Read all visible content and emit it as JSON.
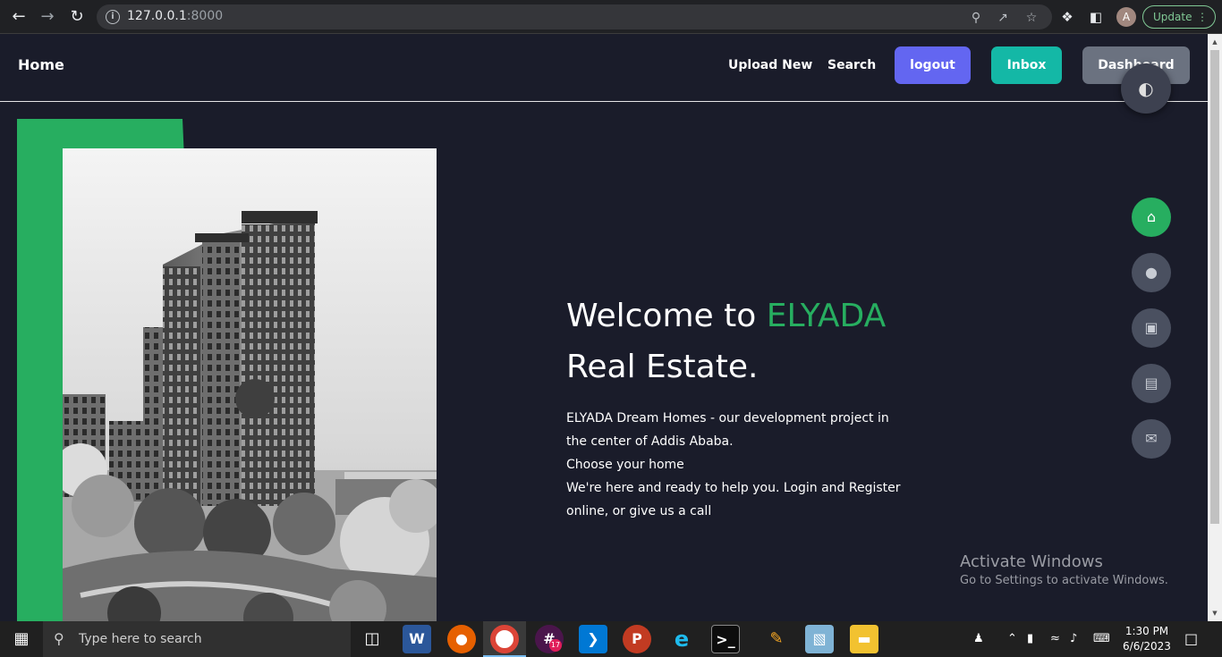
{
  "browser": {
    "url_host": "127.0.0.1",
    "url_port": ":8000",
    "profile_initial": "A",
    "update_label": "Update"
  },
  "nav": {
    "brand": "Home",
    "upload": "Upload New",
    "search": "Search",
    "logout": "logout",
    "inbox": "Inbox",
    "dashboard": "Dashboard"
  },
  "hero": {
    "title_prefix": "Welcome to ",
    "title_accent": "ELYADA",
    "title_suffix": "Real Estate.",
    "line1": "ELYADA Dream Homes - our development project in the center of Addis Ababa.",
    "line2": "Choose your home",
    "line3": "We're here and ready to help you. Login and Register online, or give us a call"
  },
  "side_menu": [
    "home-icon",
    "user-icon",
    "briefcase-icon",
    "card-icon",
    "envelope-open-icon"
  ],
  "watermark": {
    "title": "Activate Windows",
    "subtitle": "Go to Settings to activate Windows."
  },
  "taskbar": {
    "search_placeholder": "Type here to search",
    "time": "1:30 PM",
    "date": "6/6/2023",
    "slack_badge": "17"
  },
  "colors": {
    "accent_green": "#27ae60",
    "logout_purple": "#6366f1",
    "inbox_teal": "#14b8a6",
    "dashboard_gray": "#6b7280",
    "page_bg": "#1a1c2a"
  }
}
